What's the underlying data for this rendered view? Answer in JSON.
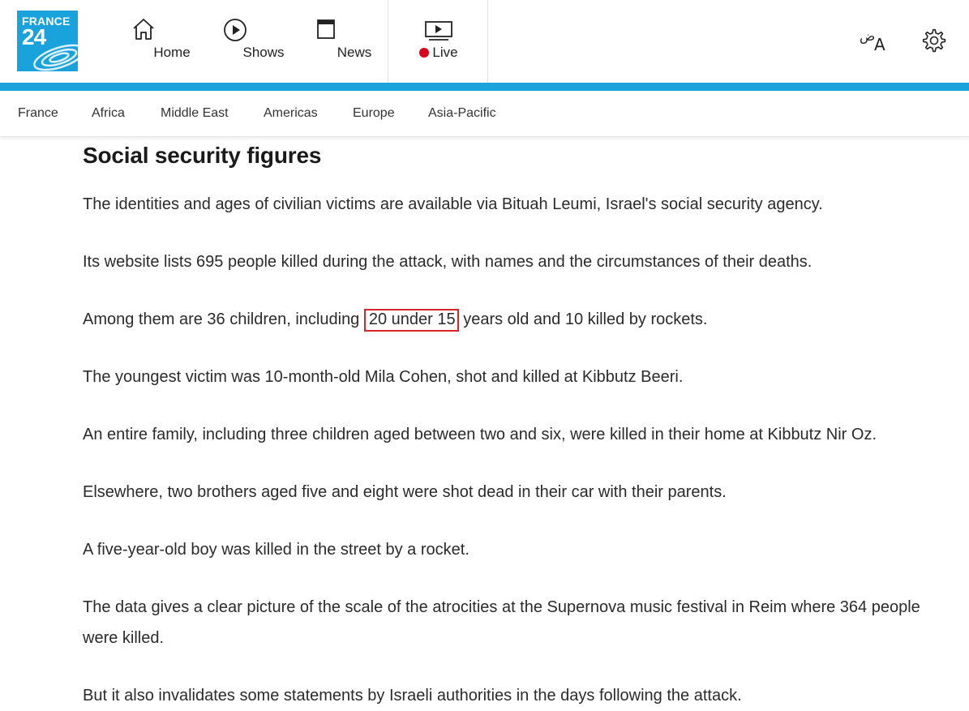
{
  "logo": {
    "line1": "FRANCE",
    "line2": "24"
  },
  "nav": {
    "home": "Home",
    "shows": "Shows",
    "news": "News",
    "live": "Live"
  },
  "subnav": [
    "France",
    "Africa",
    "Middle East",
    "Americas",
    "Europe",
    "Asia-Pacific"
  ],
  "article": {
    "heading": "Social security figures",
    "p1": "The identities and ages of civilian victims are available via Bituah Leumi, Israel's social security agency.",
    "p2": "Its website lists 695 people killed during the attack, with names and the circumstances of their deaths.",
    "p3_before": "Among them are 36 children, including ",
    "p3_highlight": "20 under 15",
    "p3_after": " years old and 10 killed by rockets.",
    "p4": "The youngest victim was 10-month-old Mila Cohen, shot and killed at Kibbutz Beeri.",
    "p5": "An entire family, including three children aged between two and six, were killed in their home at Kibbutz Nir Oz.",
    "p6": "Elsewhere, two brothers aged five and eight were shot dead in their car with their parents.",
    "p7": "A five-year-old boy was killed in the street by a rocket.",
    "p8": "The data gives a clear picture of the scale of the atrocities at the Supernova music festival in Reim where 364 people were killed.",
    "p9": "But it also invalidates some statements by Israeli authorities in the days following the attack."
  },
  "colors": {
    "brand": "#1aa2dc",
    "live": "#d9001b",
    "highlight_border": "#d9252a"
  },
  "icons": [
    "home-icon",
    "play-icon",
    "news-icon",
    "tv-icon",
    "language-icon",
    "gear-icon"
  ]
}
